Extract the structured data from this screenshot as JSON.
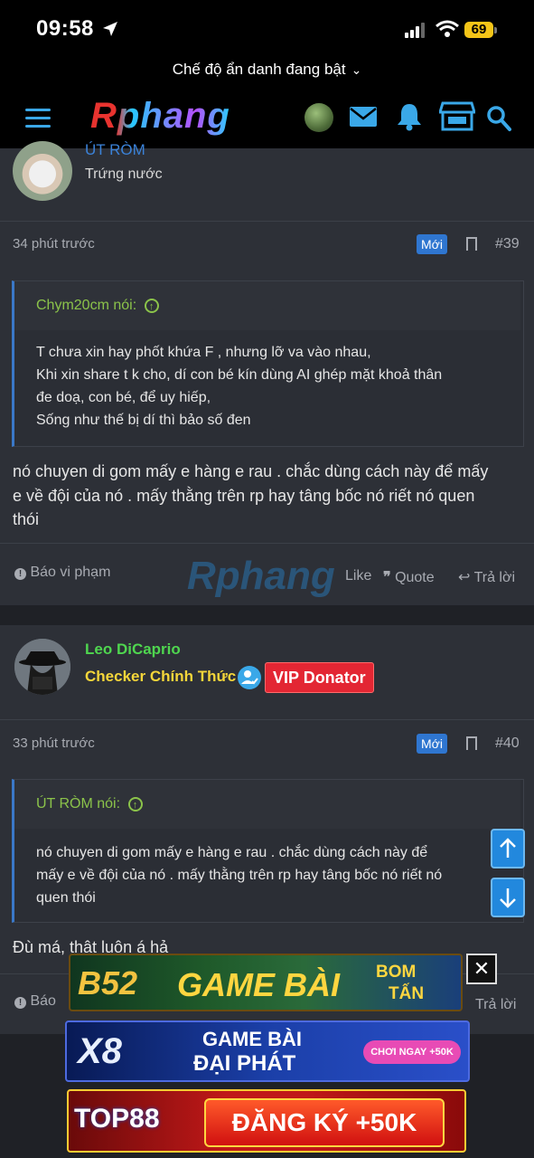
{
  "status_bar": {
    "time": "09:58",
    "battery": "69"
  },
  "browser": {
    "incognito_label": "Chế độ ẩn danh đang bật"
  },
  "header": {
    "logo": "Rphang"
  },
  "watermark": "Rphang",
  "posts": [
    {
      "author": "ÚT RÒM",
      "user_title": "Trứng nước",
      "time": "34 phút trước",
      "badge": "Mới",
      "post_number": "#39",
      "quote": {
        "author_line": "Chym20cm nói:",
        "lines": [
          "T chưa xin hay phốt khứa F , nhưng lỡ va vào nhau,",
          "Khi xin share t k cho, dí con bé kín dùng AI ghép mặt khoả thân",
          "đe doạ, con bé, để uy hiếp,",
          "Sống như thế bị dí thì bảo số đen"
        ]
      },
      "message_lines": [
        "nó chuyen di gom mấy e hàng e rau . chắc dùng cách này để mấy",
        "e về đội của nó . mấy thằng trên rp hay tâng bốc nó riết nó quen",
        "thói"
      ],
      "actions": {
        "report": "Báo vi phạm",
        "like": "Like",
        "quote": "Quote",
        "reply": "Trả lời"
      }
    },
    {
      "author": "Leo DiCaprio",
      "user_title": "Checker Chính Thức",
      "vip_badge": "VIP Donator",
      "time": "33 phút trước",
      "badge": "Mới",
      "post_number": "#40",
      "quote": {
        "author_line": "ÚT RÒM nói:",
        "lines": [
          "nó chuyen di gom mấy e hàng e rau . chắc dùng cách này để",
          "mấy e về đội của nó . mấy thằng trên rp hay tâng bốc nó riết nó",
          "quen thói"
        ]
      },
      "message_lines": [
        "Đù má, thật luôn á hả"
      ],
      "actions": {
        "report": "Báo",
        "reply": "Trả lời"
      }
    }
  ],
  "ads": [
    {
      "name": "b52",
      "texts": [
        "B52",
        "GAME BÀI",
        "BOM",
        "TẤN"
      ]
    },
    {
      "name": "x8",
      "texts": [
        "X8",
        "GAME BÀI",
        "ĐẠI PHÁT",
        "CHƠI NGAY +50K"
      ]
    },
    {
      "name": "top88",
      "texts": [
        "TOP88",
        "ĐĂNG KÝ +50K"
      ]
    }
  ],
  "colors": {
    "accent": "#3aa8e8",
    "new_badge": "#2f76d0",
    "vip": "#e32633",
    "quote_author": "#8bc34a"
  }
}
